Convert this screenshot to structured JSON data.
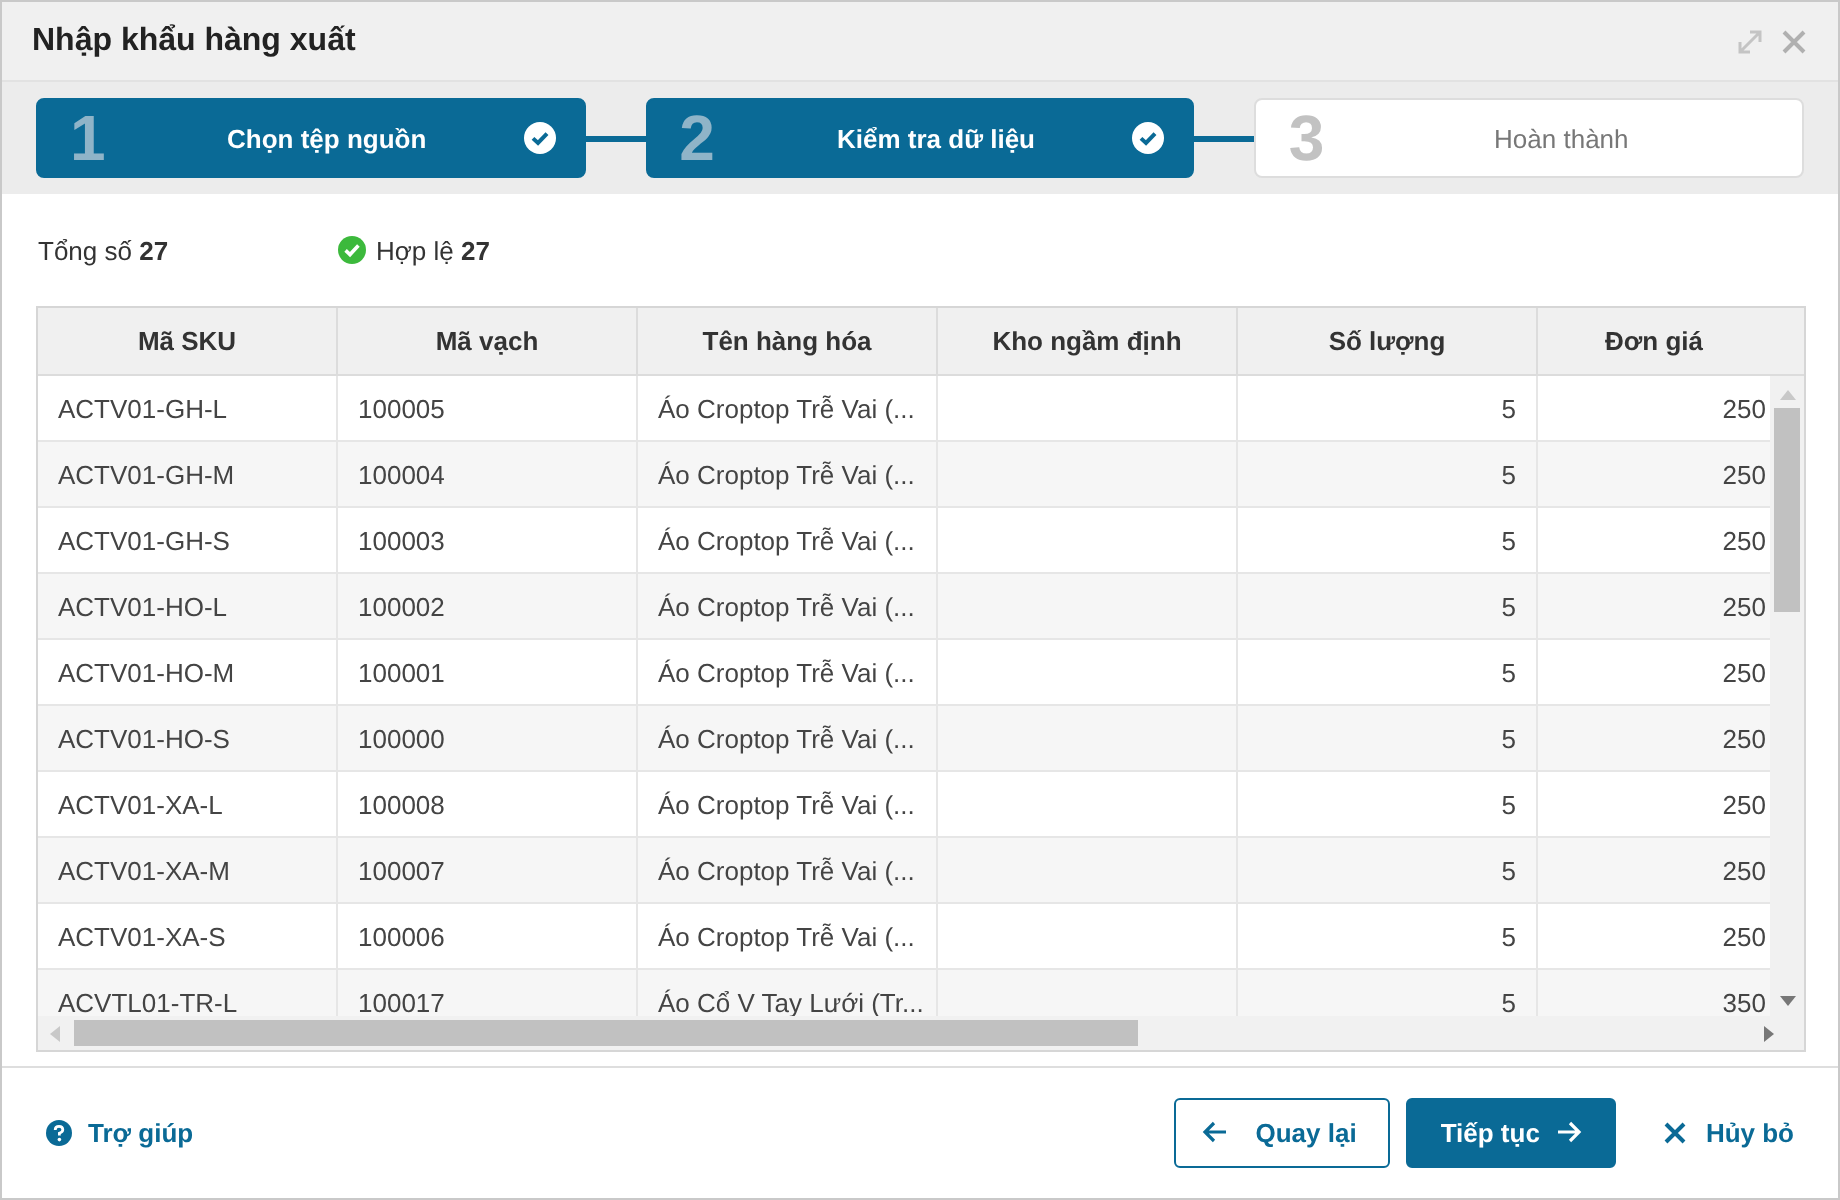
{
  "window": {
    "title": "Nhập khẩu hàng xuất"
  },
  "steps": [
    {
      "number": "1",
      "label": "Chọn tệp nguồn",
      "completed": true
    },
    {
      "number": "2",
      "label": "Kiểm tra dữ liệu",
      "completed": true
    },
    {
      "number": "3",
      "label": "Hoàn thành",
      "completed": false
    }
  ],
  "summary": {
    "total": "Tổng số **27**",
    "valid": "Hợp lệ **27**"
  },
  "table": {
    "columns": [
      {
        "label": "Mã SKU",
        "kind": "text"
      },
      {
        "label": "Mã vạch",
        "kind": "text"
      },
      {
        "label": "Tên hàng hóa",
        "kind": "text"
      },
      {
        "label": "Kho ngầm định",
        "kind": "text"
      },
      {
        "label": "Số lượng",
        "kind": "number"
      },
      {
        "label": "Đơn giá",
        "kind": "number"
      }
    ],
    "rows": [
      [
        "ACTV01-GH-L",
        "100005",
        "Áo Croptop Trễ Vai (...",
        null,
        "5",
        "250"
      ],
      [
        "ACTV01-GH-M",
        "100004",
        "Áo Croptop Trễ Vai (...",
        null,
        "5",
        "250"
      ],
      [
        "ACTV01-GH-S",
        "100003",
        "Áo Croptop Trễ Vai (...",
        null,
        "5",
        "250"
      ],
      [
        "ACTV01-HO-L",
        "100002",
        "Áo Croptop Trễ Vai (...",
        null,
        "5",
        "250"
      ],
      [
        "ACTV01-HO-M",
        "100001",
        "Áo Croptop Trễ Vai (...",
        null,
        "5",
        "250"
      ],
      [
        "ACTV01-HO-S",
        "100000",
        "Áo Croptop Trễ Vai (...",
        null,
        "5",
        "250"
      ],
      [
        "ACTV01-XA-L",
        "100008",
        "Áo Croptop Trễ Vai (...",
        null,
        "5",
        "250"
      ],
      [
        "ACTV01-XA-M",
        "100007",
        "Áo Croptop Trễ Vai (...",
        null,
        "5",
        "250"
      ],
      [
        "ACTV01-XA-S",
        "100006",
        "Áo Croptop Trễ Vai (...",
        null,
        "5",
        "250"
      ],
      [
        "ACVTL01-TR-L",
        "100017",
        "Áo Cổ V Tay Lưới (Tr...",
        null,
        "5",
        "350"
      ]
    ]
  },
  "footer": {
    "help": "Trợ giúp",
    "back": "Quay lại",
    "next": "Tiếp tục",
    "cancel": "Hủy bỏ"
  }
}
